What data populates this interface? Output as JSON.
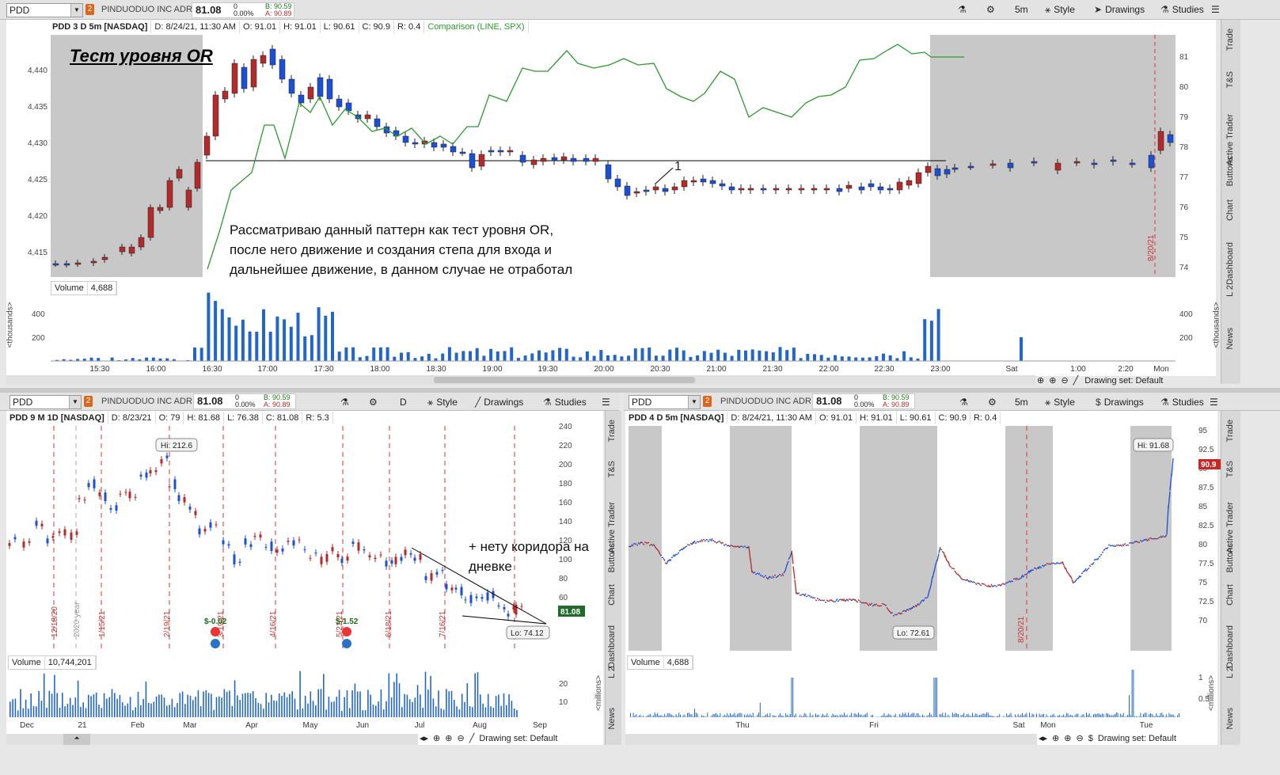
{
  "top": {
    "symbol": "PDD",
    "link_num": "2",
    "company": "PINDUODUO INC ADR",
    "last": "81.08",
    "change": "0",
    "change_pct": "0.00%",
    "bid": "B: 90.59",
    "ask": "A: 90.89",
    "toolbar": {
      "timeframe": "5m",
      "style": "Style",
      "drawings": "Drawings",
      "studies": "Studies"
    },
    "header": {
      "title": "PDD 3 D 5m [NASDAQ]",
      "date": "D: 8/24/21, 11:30 AM",
      "open": "O: 91.01",
      "high": "H: 91.01",
      "low": "L: 90.61",
      "close": "C: 90.9",
      "range": "R: 0.4",
      "comparison": "Comparison (LINE, SPX)"
    },
    "annotation_title": "Тест уровня OR",
    "annotation_text": [
      "Рассматриваю данный паттерн как тест уровня OR,",
      "после него движение и создания степа для входа и",
      "дальнейшее движение, в данном случае не отработал"
    ],
    "marker_1": "1",
    "left_axis": [
      "4,440",
      "4,435",
      "4,430",
      "4,425",
      "4,420",
      "4,415"
    ],
    "right_axis": [
      "81",
      "80",
      "79",
      "78",
      "77",
      "76",
      "75",
      "74"
    ],
    "date_marker": "8/20/21",
    "volume_label": "Volume",
    "volume_value": "4,688",
    "volume_axis": [
      "400",
      "200"
    ],
    "volume_unit": "<thousands>",
    "time_axis": [
      "15:30",
      "16:00",
      "16:30",
      "17:00",
      "17:30",
      "18:00",
      "18:30",
      "19:00",
      "19:30",
      "20:00",
      "20:30",
      "21:00",
      "21:30",
      "22:00",
      "22:30",
      "23:00",
      "Sat",
      "1:00",
      "2:20",
      "Mon"
    ],
    "drawing_set": "Drawing set: Default",
    "side_tabs": [
      "Trade",
      "T&S",
      "Active Trader",
      "Buttons",
      "Chart",
      "Dashboard",
      "L 2",
      "News"
    ]
  },
  "bottom_left": {
    "symbol": "PDD",
    "link_num": "2",
    "company": "PINDUODUO INC ADR",
    "last": "81.08",
    "change": "0",
    "change_pct": "0.00%",
    "bid": "B: 90.59",
    "ask": "A: 90.89",
    "toolbar": {
      "timeframe": "D",
      "style": "Style",
      "drawings": "Drawings",
      "studies": "Studies"
    },
    "header": {
      "title": "PDD 9 M 1D [NASDAQ]",
      "date": "D: 8/23/21",
      "open": "O: 79",
      "high": "H: 81.68",
      "low": "L: 76.38",
      "close": "C: 81.08",
      "range": "R: 5.3"
    },
    "hi_label": "Hi: 212.6",
    "lo_label": "Lo: 74.12",
    "price_tag": "81.08",
    "annotation": [
      "+ нету коридора на",
      "дневке"
    ],
    "right_axis": [
      "240",
      "220",
      "200",
      "180",
      "160",
      "140",
      "120",
      "100",
      "80",
      "60"
    ],
    "vertical_dates": [
      "12/18/20",
      "2020 year",
      "1/15/21",
      "2/19/21",
      "3/19/21",
      "4/16/21",
      "5/21/21",
      "6/18/21",
      "7/16/21"
    ],
    "earnings": [
      "$-0.02",
      "$-1.52"
    ],
    "volume_label": "Volume",
    "volume_value": "10,744,201",
    "volume_axis": [
      "20",
      "10"
    ],
    "volume_unit": "<millions>",
    "time_axis": [
      "Dec",
      "21",
      "Feb",
      "Mar",
      "Apr",
      "May",
      "Jun",
      "Jul",
      "Aug",
      "Sep"
    ],
    "drawing_set": "Drawing set: Default",
    "side_tabs": [
      "Trade",
      "T&S",
      "Active Trader",
      "Buttons",
      "Chart",
      "Dashboard",
      "L 2",
      "News"
    ]
  },
  "bottom_right": {
    "symbol": "PDD",
    "link_num": "2",
    "company": "PINDUODUO INC ADR",
    "last": "81.08",
    "change": "0",
    "change_pct": "0.00%",
    "bid": "B: 90.59",
    "ask": "A: 90.89",
    "toolbar": {
      "timeframe": "5m",
      "style": "Style",
      "drawings": "Drawings",
      "studies": "Studies"
    },
    "header": {
      "title": "PDD 4 D 5m [NASDAQ]",
      "date": "D: 8/24/21, 11:30 AM",
      "open": "O: 91.01",
      "high": "H: 91.01",
      "low": "L: 90.61",
      "close": "C: 90.9",
      "range": "R: 0.4"
    },
    "hi_label": "Hi: 91.68",
    "lo_label": "Lo: 72.61",
    "price_tag": "90.9",
    "date_marker": "8/20/21",
    "right_axis": [
      "95",
      "92.5",
      "90",
      "87.5",
      "85",
      "82.5",
      "80",
      "77.5",
      "75",
      "72.5",
      "70"
    ],
    "volume_label": "Volume",
    "volume_value": "4,688",
    "volume_axis": [
      "1",
      "0.5"
    ],
    "volume_unit": "<millions>",
    "time_axis": [
      "Thu",
      "Fri",
      "Sat",
      "Mon",
      "Tue"
    ],
    "drawing_set": "Drawing set: Default",
    "side_tabs": [
      "Trade",
      "T&S",
      "Active Trader",
      "Buttons",
      "Chart",
      "Dashboard",
      "L 2",
      "News"
    ]
  },
  "colors": {
    "up": "#1a4fd6",
    "down": "#b22a2a",
    "comparison": "#2a9a2a",
    "orange": "#d9661e",
    "session_shade": "#c8c8c8"
  }
}
